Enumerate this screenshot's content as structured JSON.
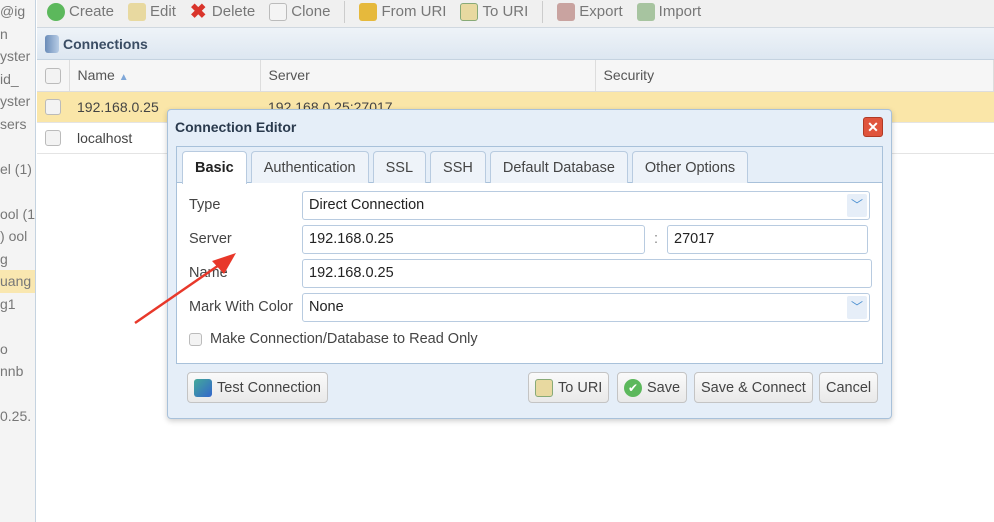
{
  "sidebar": {
    "fragments": [
      "ig@",
      "n",
      "yster",
      "_id",
      "yster",
      "sers",
      "",
      "el (1)",
      "",
      "ool (1",
      "ool (",
      "g",
      "uang",
      "g1",
      "",
      "o",
      "nnb",
      "",
      ".0.25"
    ]
  },
  "toolbar": {
    "create": "Create",
    "edit": "Edit",
    "delete": "Delete",
    "clone": "Clone",
    "from_uri": "From URI",
    "to_uri": "To URI",
    "export": "Export",
    "import": "Import"
  },
  "connections": {
    "title": "Connections",
    "columns": [
      "Name",
      "Server",
      "Security"
    ],
    "rows": [
      {
        "name": "192.168.0.25",
        "server": "192.168.0.25:27017",
        "security": ""
      },
      {
        "name": "localhost",
        "server": "",
        "security": ""
      }
    ]
  },
  "dialog": {
    "title": "Connection Editor",
    "tabs": [
      "Basic",
      "Authentication",
      "SSL",
      "SSH",
      "Default Database",
      "Other Options"
    ],
    "active_tab": "Basic",
    "type_label": "Type",
    "type_value": "Direct Connection",
    "server_label": "Server",
    "server_host": "192.168.0.25",
    "server_sep": ":",
    "server_port": "27017",
    "name_label": "Name",
    "name_value": "192.168.0.25",
    "color_label": "Mark With Color",
    "color_value": "None",
    "readonly_label": "Make Connection/Database to Read Only",
    "readonly_checked": false,
    "buttons": {
      "test": "Test Connection",
      "to_uri": "To URI",
      "save": "Save",
      "save_connect": "Save & Connect",
      "cancel": "Cancel"
    }
  },
  "annotation": {
    "arrow_color": "#e8382a"
  }
}
